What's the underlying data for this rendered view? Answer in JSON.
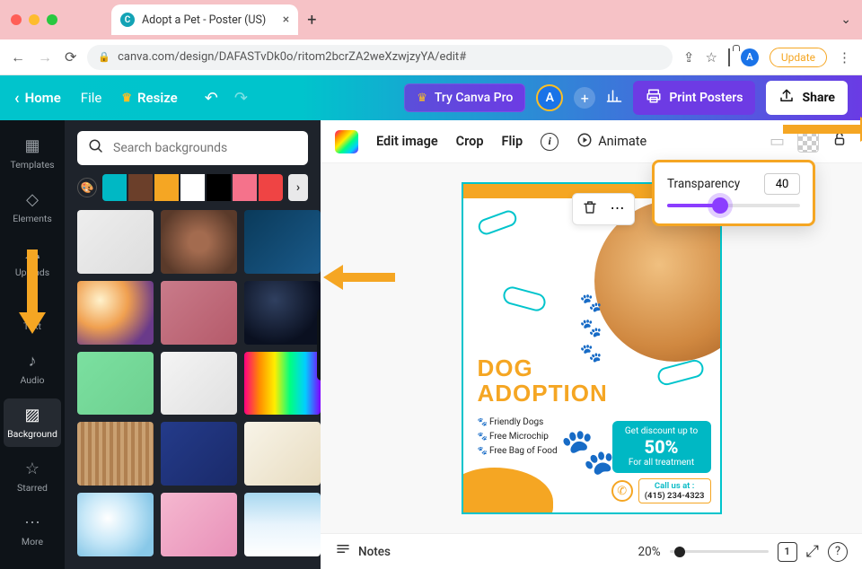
{
  "browser": {
    "traffic_colors": [
      "#ff5f57",
      "#febc2e",
      "#28c840"
    ],
    "tab_title": "Adopt a Pet - Poster (US)",
    "tab_favicon_letter": "C",
    "address_url": "canva.com/design/DAFASTvDk0o/ritom2bcrZA2weXzwjzyYA/edit#",
    "avatar_letter": "A",
    "update_label": "Update"
  },
  "header": {
    "home": "Home",
    "file": "File",
    "resize": "Resize",
    "try_pro": "Try Canva Pro",
    "avatar_letter": "A",
    "print": "Print Posters",
    "share": "Share"
  },
  "rail": {
    "items": [
      {
        "label": "Templates",
        "icon": "templates"
      },
      {
        "label": "Elements",
        "icon": "elements"
      },
      {
        "label": "Uploads",
        "icon": "uploads"
      },
      {
        "label": "Text",
        "icon": "text"
      },
      {
        "label": "Audio",
        "icon": "audio"
      },
      {
        "label": "Background",
        "icon": "background",
        "active": true
      },
      {
        "label": "Starred",
        "icon": "star"
      },
      {
        "label": "More",
        "icon": "more"
      }
    ]
  },
  "panel": {
    "search_placeholder": "Search backgrounds",
    "swatch_colors": [
      "#00b8c4",
      "#6b3f2a",
      "#f5a623",
      "#ffffff",
      "#000000",
      "#f5728b",
      "#ef4444"
    ],
    "thumbs": [
      "linear-gradient(135deg,#eee,#ddd)",
      "radial-gradient(circle,#a36b4f 20%,#5a3a2a 80%)",
      "linear-gradient(135deg,#0a3a5a,#1a5a8a)",
      "radial-gradient(circle at 30% 30%,#fff2cc 0%,#f0a050 40%,#6a3a8a 80%)",
      "linear-gradient(135deg,#c97b8a,#b55a6a)",
      "radial-gradient(ellipse at 40% 30%,#304060 0%,#0a1020 70%)",
      "linear-gradient(135deg,#7be0a0,#6ed090)",
      "linear-gradient(135deg,#f4f4f4,#e0e0e0)",
      "linear-gradient(90deg,#ff0080,#ff8c00,#ffee00,#00ff80,#00cfff,#8000ff)",
      "repeating-linear-gradient(90deg,#caa172 0 4px,#b08050 4px 8px)",
      "linear-gradient(135deg,#243b8a,#1a2a6a)",
      "linear-gradient(135deg,#f8f4e8,#e8dcc0)",
      "radial-gradient(circle at 40% 40%,#fff 0%,#c8e8f8 40%,#88c8e8 80%)",
      "linear-gradient(135deg,#f5b8d0,#e890b8)",
      "linear-gradient(180deg,#a8d8f0 0%,#e8f4fc 50%,#fff 100%)"
    ]
  },
  "toolbar": {
    "edit_image": "Edit image",
    "crop": "Crop",
    "flip": "Flip",
    "animate": "Animate"
  },
  "transparency": {
    "label": "Transparency",
    "value": "40",
    "percent": 40
  },
  "poster": {
    "title_line1": "DOG",
    "title_line2": "ADOPTION",
    "features": [
      "Friendly Dogs",
      "Free Microchip",
      "Free Bag of Food"
    ],
    "promo_line1": "Get discount up to",
    "promo_line2": "50%",
    "promo_line3": "For all treatment",
    "call_label": "Call us at :",
    "phone_number": "(415) 234-4323"
  },
  "footer": {
    "notes": "Notes",
    "zoom_label": "20%",
    "page_count": "1"
  }
}
